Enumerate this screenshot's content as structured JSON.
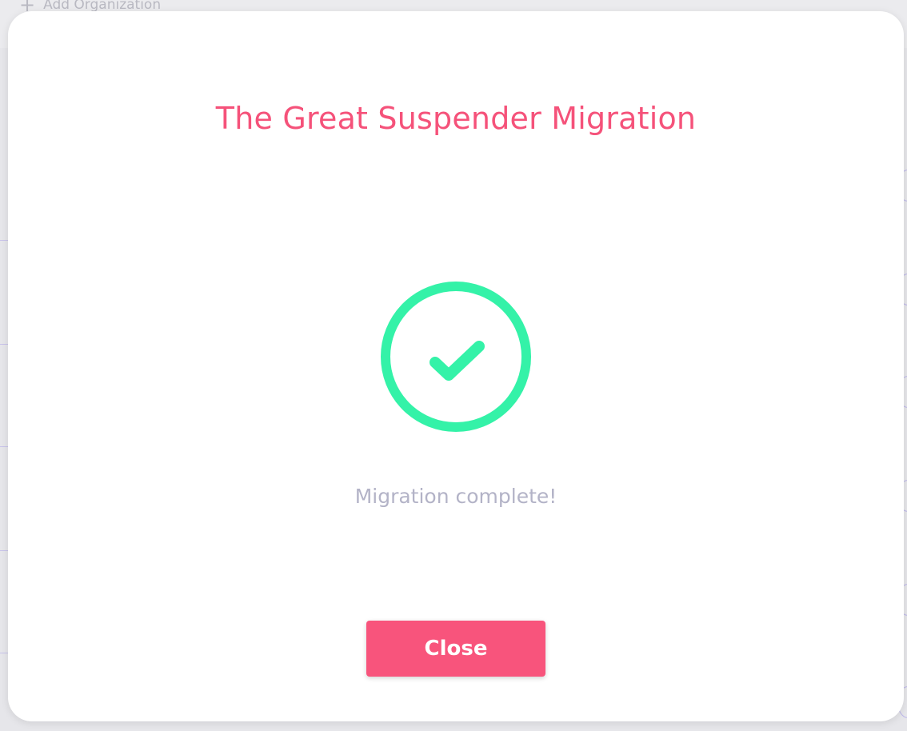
{
  "background": {
    "add_organization_label": "Add Organization",
    "plus_icon": "plus-icon"
  },
  "modal": {
    "title": "The Great Suspender Migration",
    "status_icon": "check-circle-icon",
    "status_text": "Migration complete!",
    "close_label": "Close"
  },
  "colors": {
    "accent": "#f5527a",
    "success": "#34f2a8",
    "muted_text": "#b3b3c7",
    "button_bg": "#f8547c"
  }
}
